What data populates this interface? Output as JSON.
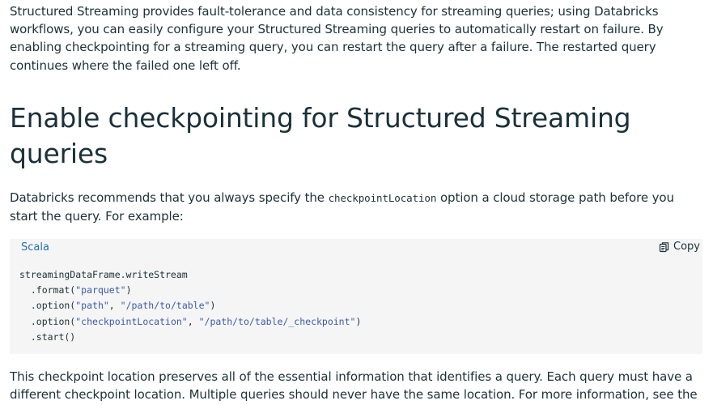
{
  "intro": {
    "text": "Structured Streaming provides fault-tolerance and data consistency for streaming queries; using Databricks workflows, you can easily configure your Structured Streaming queries to automatically restart on failure. By enabling checkpointing for a streaming query, you can restart the query after a failure. The restarted query continues where the failed one left off."
  },
  "section": {
    "heading": "Enable checkpointing for Structured Streaming queries",
    "lead_before": "Databricks recommends that you always specify the ",
    "lead_code": "checkpointLocation",
    "lead_after": " option a cloud storage path before you start the query. For example:"
  },
  "code_block": {
    "language": "Scala",
    "copy_label": "Copy",
    "copy_icon": "copy-icon",
    "lines": [
      {
        "plain": "streamingDataFrame.writeStream"
      },
      {
        "pre": "  .format(",
        "str1": "\"parquet\"",
        "post": ")"
      },
      {
        "pre": "  .option(",
        "str1": "\"path\"",
        "mid": ", ",
        "str2": "\"/path/to/table\"",
        "post": ")"
      },
      {
        "pre": "  .option(",
        "str1": "\"checkpointLocation\"",
        "mid": ", ",
        "str2": "\"/path/to/table/_checkpoint\"",
        "post": ")"
      },
      {
        "plain": "  .start()"
      }
    ]
  },
  "outro": {
    "text": "This checkpoint location preserves all of the essential information that identifies a query. Each query must have a different checkpoint location. Multiple queries should never have the same location. For more information, see the"
  },
  "colors": {
    "text": "#1b3139",
    "link": "#2272b4",
    "code_bg": "#f5f5f5",
    "string": "#3b5aa8"
  }
}
